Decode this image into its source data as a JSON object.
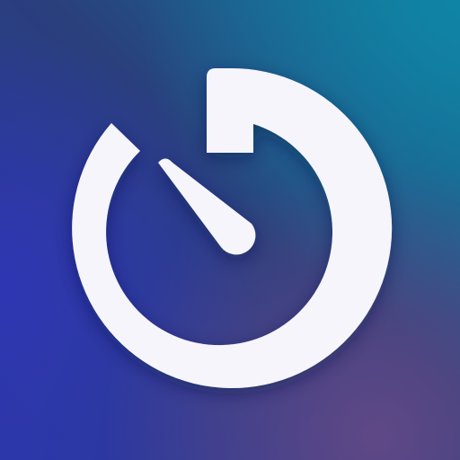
{
  "icon": {
    "name": "timer-icon",
    "colors": {
      "background_top_right": "#13779a",
      "background_top_left": "#23408a",
      "background_left": "#2b37a6",
      "background_center": "#2a3f7c",
      "background_bottom_right": "#5a4a80",
      "background_bottom": "#4b3a7a",
      "glyph": "#f6f5fb",
      "glyph_shadow": "#0d1740"
    }
  }
}
